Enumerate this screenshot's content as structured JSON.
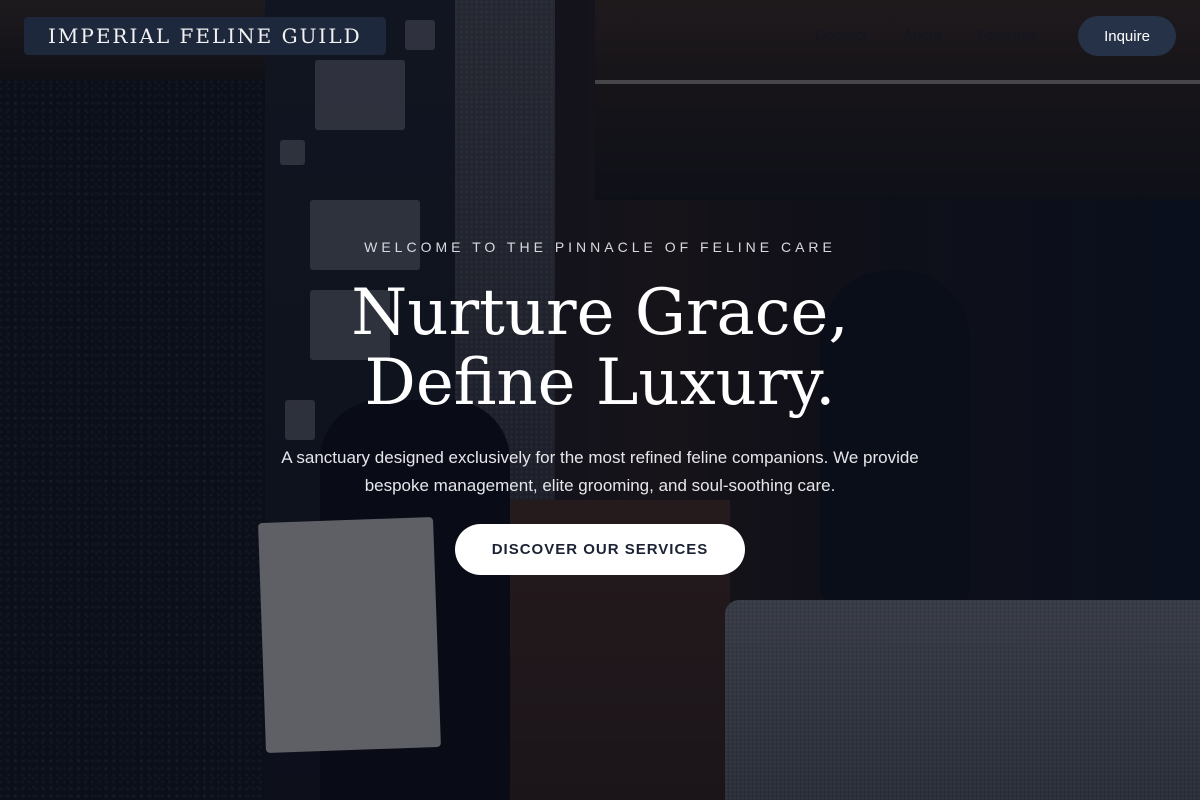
{
  "nav": {
    "brand": "IMPERIAL FELINE GUILD",
    "links": [
      "Contact",
      "About",
      "Features"
    ],
    "cta_label": "Inquire"
  },
  "hero": {
    "eyebrow": "WELCOME TO THE PINNACLE OF FELINE CARE",
    "headline_line1": "Nurture Grace,",
    "headline_line2": "Define Luxury.",
    "description": "A sanctuary designed exclusively for the most refined feline companions. We provide bespoke management, elite grooming, and soul-soothing care.",
    "cta_label": "DISCOVER OUR SERVICES"
  },
  "colors": {
    "overlay": "#080c1c",
    "brand_bg": "#202c42",
    "inquire_bg": "#263247",
    "cta_bg": "#ffffff",
    "cta_text": "#1b2233"
  }
}
